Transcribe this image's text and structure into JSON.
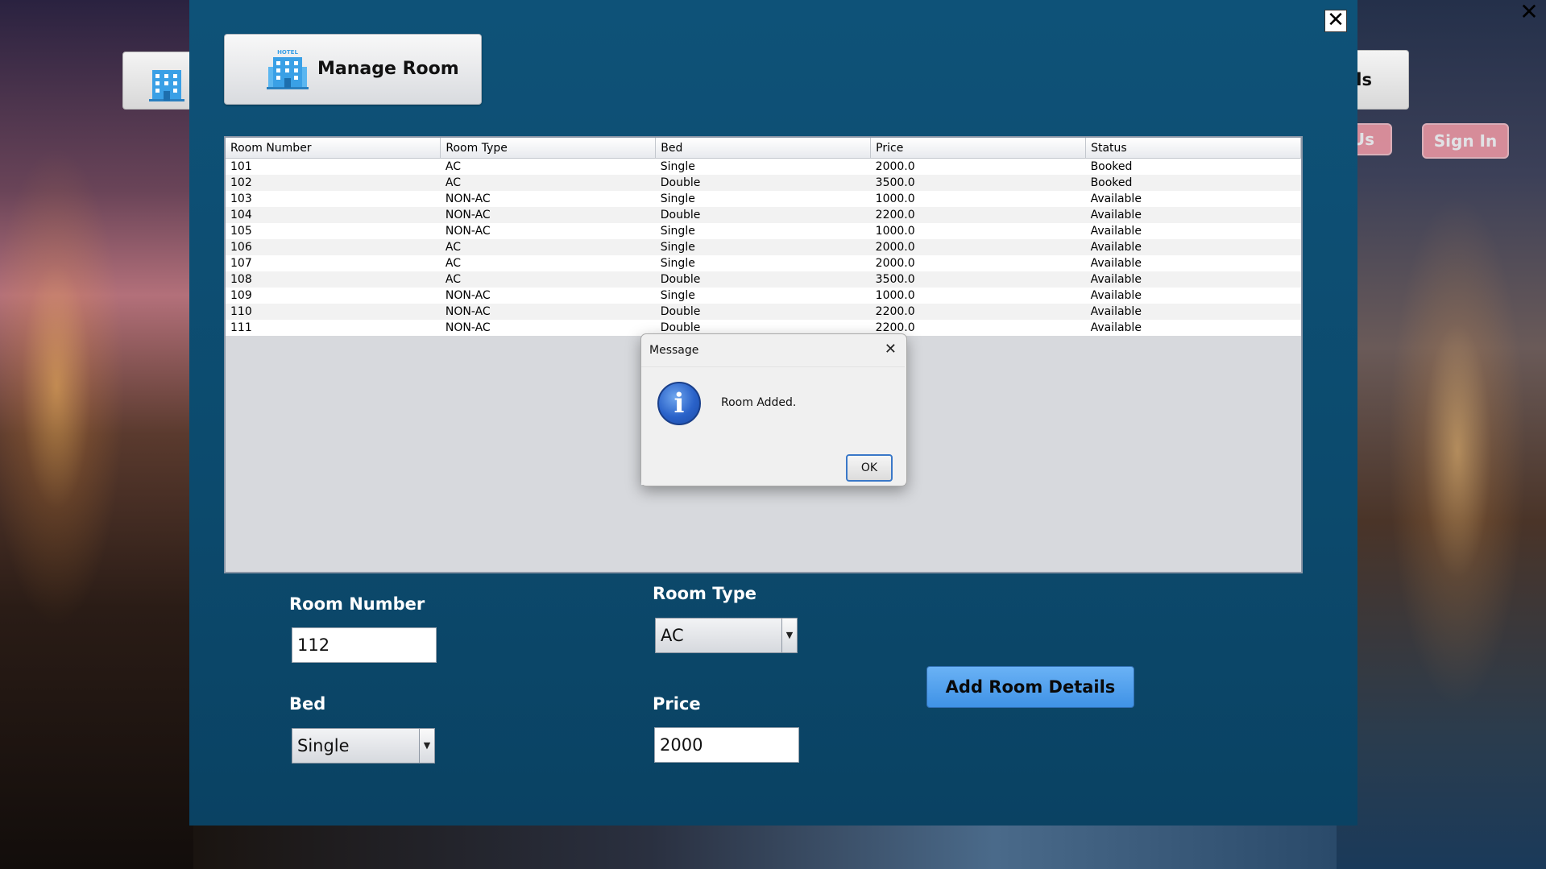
{
  "background": {
    "nav_partial_label": "ls",
    "about_partial_label": "Us",
    "sign_in_label": "Sign In"
  },
  "header": {
    "title": "Manage Room",
    "logo_text": "HOTEL"
  },
  "table": {
    "columns": [
      "Room Number",
      "Room  Type",
      "Bed",
      "Price",
      "Status"
    ],
    "rows": [
      [
        "101",
        "AC",
        "Single",
        "2000.0",
        "Booked"
      ],
      [
        "102",
        "AC",
        "Double",
        "3500.0",
        "Booked"
      ],
      [
        "103",
        "NON-AC",
        "Single",
        "1000.0",
        "Available"
      ],
      [
        "104",
        "NON-AC",
        "Double",
        "2200.0",
        "Available"
      ],
      [
        "105",
        "NON-AC",
        "Single",
        "1000.0",
        "Available"
      ],
      [
        "106",
        "AC",
        "Single",
        "2000.0",
        "Available"
      ],
      [
        "107",
        "AC",
        "Single",
        "2000.0",
        "Available"
      ],
      [
        "108",
        "AC",
        "Double",
        "3500.0",
        "Available"
      ],
      [
        "109",
        "NON-AC",
        "Single",
        "1000.0",
        "Available"
      ],
      [
        "110",
        "NON-AC",
        "Double",
        "2200.0",
        "Available"
      ],
      [
        "111",
        "NON-AC",
        "Double",
        "2200.0",
        "Available"
      ]
    ]
  },
  "dialog": {
    "title": "Message",
    "message": "Room Added.",
    "ok_label": "OK",
    "icon": "info-icon"
  },
  "form": {
    "room_number_label": "Room Number",
    "room_number_value": "112",
    "room_type_label": "Room Type",
    "room_type_value": "AC",
    "bed_label": "Bed",
    "bed_value": "Single",
    "price_label": "Price",
    "price_value": "2000",
    "add_button_label": "Add Room Details"
  },
  "colors": {
    "frame": "#0c4a6d",
    "add_button": "#4a9cec",
    "pink_button": "#f29aa6"
  }
}
